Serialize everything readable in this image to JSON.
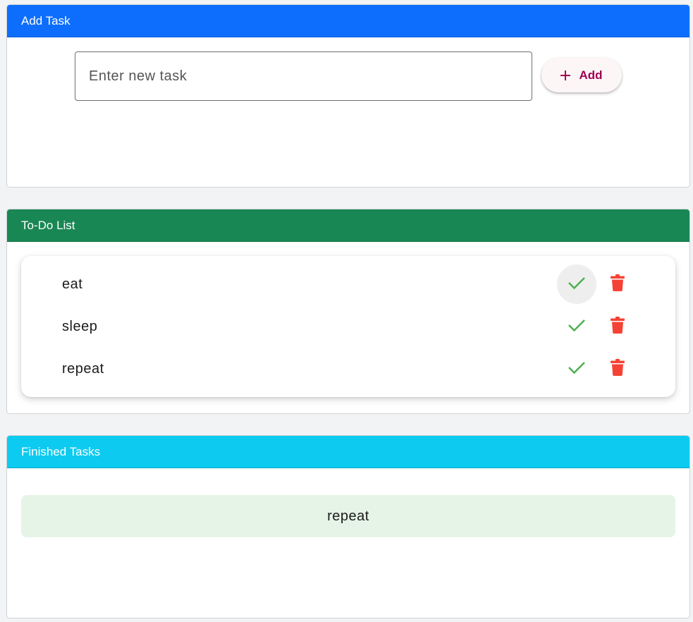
{
  "colors": {
    "add_header": "#0d6efd",
    "todo_header": "#198754",
    "finished_header": "#0dcaf0",
    "check": "#4caf50",
    "trash": "#f44336",
    "add_button_text": "#a00050"
  },
  "add_card": {
    "title": "Add Task",
    "input_placeholder": "Enter new task",
    "input_value": "",
    "add_button_label": "Add",
    "add_button_icon": "plus-icon"
  },
  "todo_card": {
    "title": "To-Do List",
    "items": [
      {
        "text": "eat",
        "check_icon": "check-icon",
        "delete_icon": "trash-icon"
      },
      {
        "text": "sleep",
        "check_icon": "check-icon",
        "delete_icon": "trash-icon"
      },
      {
        "text": "repeat",
        "check_icon": "check-icon",
        "delete_icon": "trash-icon"
      }
    ]
  },
  "finished_card": {
    "title": "Finished Tasks",
    "items": [
      {
        "text": "repeat"
      }
    ]
  }
}
